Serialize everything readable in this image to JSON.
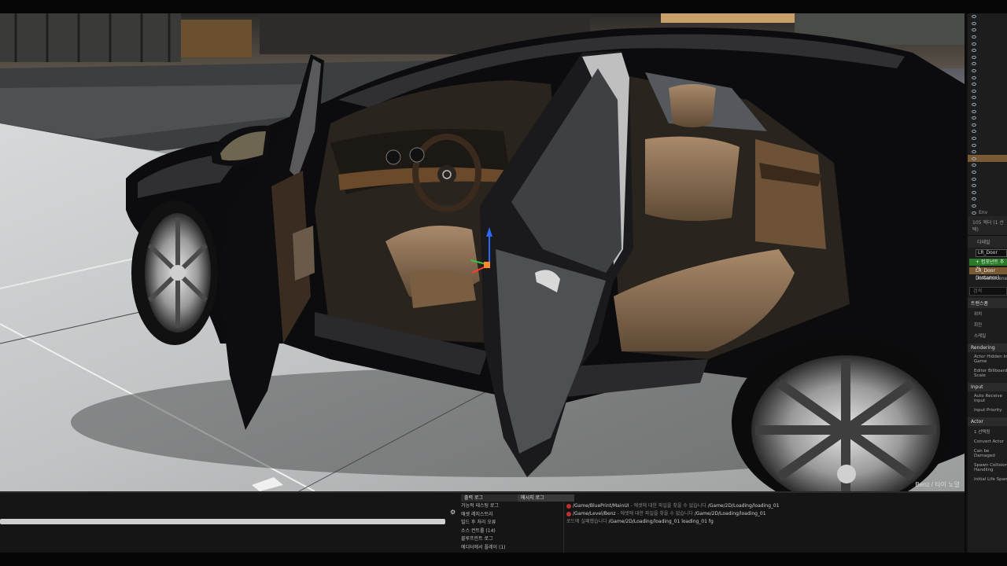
{
  "viewport": {
    "label": "Benz / 타이 노멀"
  },
  "outliner": {
    "count_text": "105 액터 (1 선택)",
    "item_count": 30,
    "last_item": "Env"
  },
  "details": {
    "tab_label": "디테일",
    "actor_name": "LR_Door",
    "add_component": "+ 컴포넌트 추가",
    "component_selected": "LR_Door (Instance)",
    "component_root": "DefaultSceneRoot",
    "search_placeholder": "검색",
    "sections": [
      {
        "title": "트랜스폼",
        "props": [
          "위치",
          "회전",
          "스케일"
        ]
      },
      {
        "title": "Rendering",
        "props": [
          "Actor Hidden In Game",
          "Editor Billboard Scale"
        ]
      },
      {
        "title": "Input",
        "props": [
          "Auto Receive Input",
          "Input Priority"
        ]
      },
      {
        "title": "Actor",
        "props": [
          "1 선택됨",
          "Convert Actor",
          "Can be Damaged",
          "Spawn Collision Handling",
          "Initial Life Span"
        ]
      }
    ]
  },
  "bottom": {
    "tab_output": "출력 로그",
    "tab_messages": "메시지 로그",
    "log_categories": [
      "가능적 테스팅 로그",
      "애셋 레지스트리",
      "빌드 후 처리 오류",
      "소스 컨트롤 (14)",
      "블루프린트 로그",
      "에디터에서 플레이 (1)"
    ],
    "messages": [
      {
        "path": "/Game/BluePrint/MainUI",
        "text": " - 에셋에 대한 파일을 찾을 수 없습니다 ",
        "path2": "/Game/2D/Loading/loading_01"
      },
      {
        "path": "/Game/Level/Benz",
        "text": " - 에셋에 대한 파일을 찾을 수 없습니다 ",
        "path2": "/Game/2D/Loading/loading_01"
      },
      {
        "path": "/Game/2D/Loading/loading_01 loading_01",
        "text": "로드에 실패했습니다 ",
        "path2": "fg"
      }
    ]
  },
  "colors": {
    "car_body": "#0c0c0e",
    "leather": "#8a6e4e",
    "selection": "#7a5a35",
    "add_button": "#2a7a2a",
    "error": "#c03030"
  }
}
